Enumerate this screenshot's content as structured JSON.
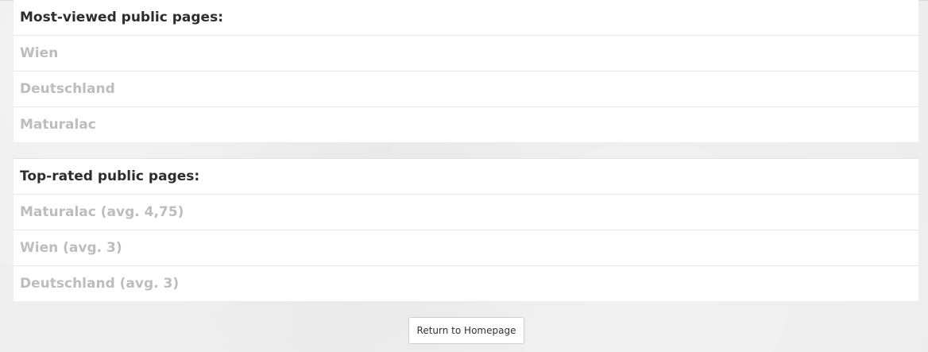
{
  "most_viewed": {
    "heading": "Most-viewed public pages:",
    "items": [
      "Wien",
      "Deutschland",
      "Maturalac"
    ]
  },
  "top_rated": {
    "heading": "Top-rated public pages:",
    "items": [
      "Maturalac (avg. 4,75)",
      "Wien (avg. 3)",
      "Deutschland (avg. 3)"
    ]
  },
  "return_button": {
    "label": "Return to Homepage"
  },
  "colors": {
    "page_background": "#ededed",
    "panel_background": "#ffffff",
    "heading_text": "#2d2d2d",
    "item_text": "#bdbdbd",
    "divider": "#e5e5e5"
  }
}
